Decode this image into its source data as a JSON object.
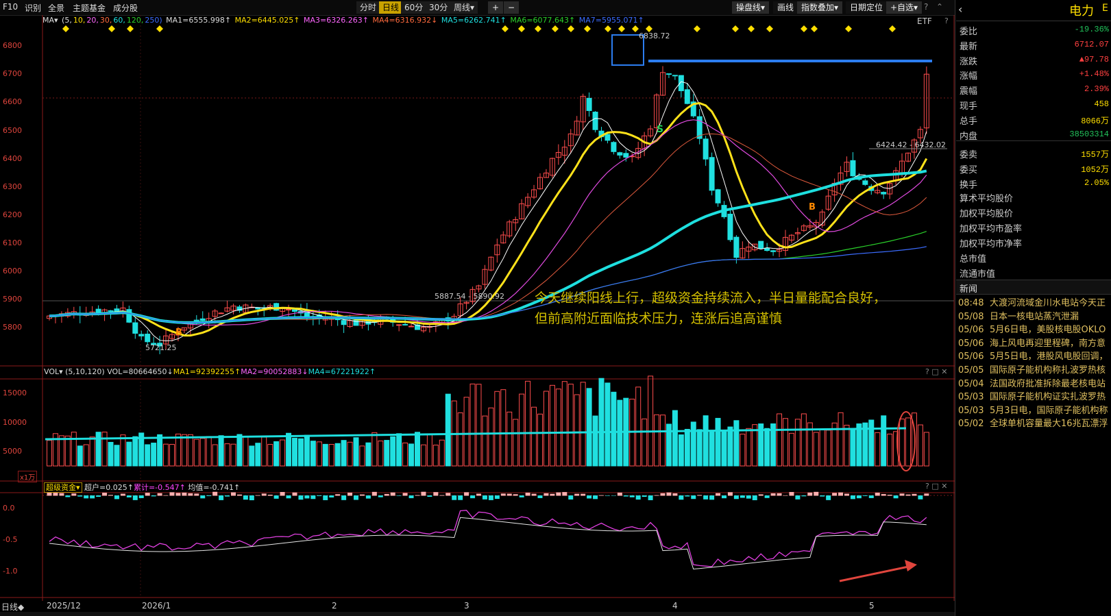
{
  "topbar": {
    "left_items": [
      "F10",
      "识别",
      "全景",
      "主题基金",
      "成分股"
    ],
    "timeframes": [
      "分时",
      "日线",
      "60分",
      "30分",
      "周线▾"
    ],
    "active_timeframe": "日线",
    "zoom": [
      "+",
      "−"
    ],
    "right_buttons": [
      "操盘线▾",
      "画线",
      "指数叠加▾",
      "日期定位",
      "+自选▾"
    ],
    "help": "?"
  },
  "ma_line": {
    "label": "MA▾",
    "periods_open": "(5,",
    "p10": "10,",
    "p20": "20,",
    "p30": "30,",
    "p60": "60,",
    "p120": "120,",
    "p250": "250)",
    "ma1": "MA1=6555.998↑",
    "ma2": "MA2=6445.025↑",
    "ma3": "MA3=6326.263↑",
    "ma4": "MA4=6316.932↓",
    "ma5": "MA5=6262.741↑",
    "ma6": "MA6=6077.643↑",
    "ma7": "MA7=5955.071↑",
    "etf": "ETF",
    "q": "?"
  },
  "price_axis": [
    "6800",
    "6700",
    "6600",
    "6500",
    "6400",
    "6300",
    "6200",
    "6100",
    "6000",
    "5900",
    "5800"
  ],
  "chart_labels": {
    "high": "6838.72",
    "low": "5721.25",
    "range1": "5887.54 - 5890.92",
    "range2": "6424.42 - 6432.02",
    "S": "S",
    "B": "B"
  },
  "annotation": {
    "line1": "今天继续阳线上行，超级资金持续流入，半日量能配合良好，",
    "line2": "但前高附近面临技术压力，连涨后追高谨慎"
  },
  "vol_panel": {
    "label": "VOL▾",
    "params": "(5,10,120)",
    "vol": "VOL=80664650↓",
    "ma1": "MA1=92392255↑",
    "ma2": "MA2=90052883↓",
    "ma4": "MA4=67221922↑",
    "axis": [
      "15000",
      "10000",
      "5000"
    ],
    "unit": "x1万"
  },
  "fund_panel": {
    "label": "超级资金▾",
    "chaohu": "超户=0.025↑",
    "leiji": "累计=-0.547↑",
    "junzhi": "均值=-0.741↑",
    "axis": [
      "0.0",
      "-0.5",
      "-1.0"
    ]
  },
  "date_axis": {
    "period": "日线◆",
    "labels": [
      "2025/12",
      "2026/1",
      "2",
      "3",
      "4",
      "5"
    ]
  },
  "right_panel": {
    "title": "电力",
    "title_suffix": "E",
    "rows": [
      {
        "k": "委比",
        "v": "-19.36%",
        "c": "#21c25a"
      },
      {
        "k": "最新",
        "v": "6712.07",
        "c": "#ff4040"
      },
      {
        "k": "涨跌",
        "v": "▲97.78",
        "c": "#ff4040"
      },
      {
        "k": "涨幅",
        "v": "+1.48%",
        "c": "#ff4040"
      },
      {
        "k": "震幅",
        "v": "2.39%",
        "c": "#ff4040"
      },
      {
        "k": "现手",
        "v": "458",
        "c": "#ffdf00"
      },
      {
        "k": "总手",
        "v": "8066万",
        "c": "#ffdf00"
      },
      {
        "k": "内盘",
        "v": "38503314",
        "c": "#21c25a"
      },
      {
        "k": "委卖",
        "v": "1557万",
        "c": "#ffdf00"
      },
      {
        "k": "委买",
        "v": "1052万",
        "c": "#ffdf00"
      },
      {
        "k": "换手",
        "v": "2.05%",
        "c": "#ffdf00"
      }
    ],
    "extra": [
      "算术平均股价",
      "加权平均股价",
      "加权平均市盈率",
      "加权平均市净率",
      "总市值",
      "流通市值"
    ],
    "news_title": "新闻",
    "news": [
      {
        "t": "08:48",
        "h": "大渡河流域金川水电站今天正"
      },
      {
        "t": "05/08",
        "h": "日本一核电站蒸汽泄漏"
      },
      {
        "t": "05/06",
        "h": "5月6日电，美股核电股OKLO"
      },
      {
        "t": "05/06",
        "h": "海上风电再迎里程碑，南方意"
      },
      {
        "t": "05/06",
        "h": "5月5日电，港股风电股回调，"
      },
      {
        "t": "05/05",
        "h": "国际原子能机构称扎波罗热核"
      },
      {
        "t": "05/04",
        "h": "法国政府批准拆除最老核电站"
      },
      {
        "t": "05/03",
        "h": "国际原子能机构证实扎波罗热"
      },
      {
        "t": "05/03",
        "h": "5月3日电，国际原子能机构称"
      },
      {
        "t": "05/02",
        "h": "全球单机容量最大16兆瓦漂浮"
      }
    ]
  }
}
